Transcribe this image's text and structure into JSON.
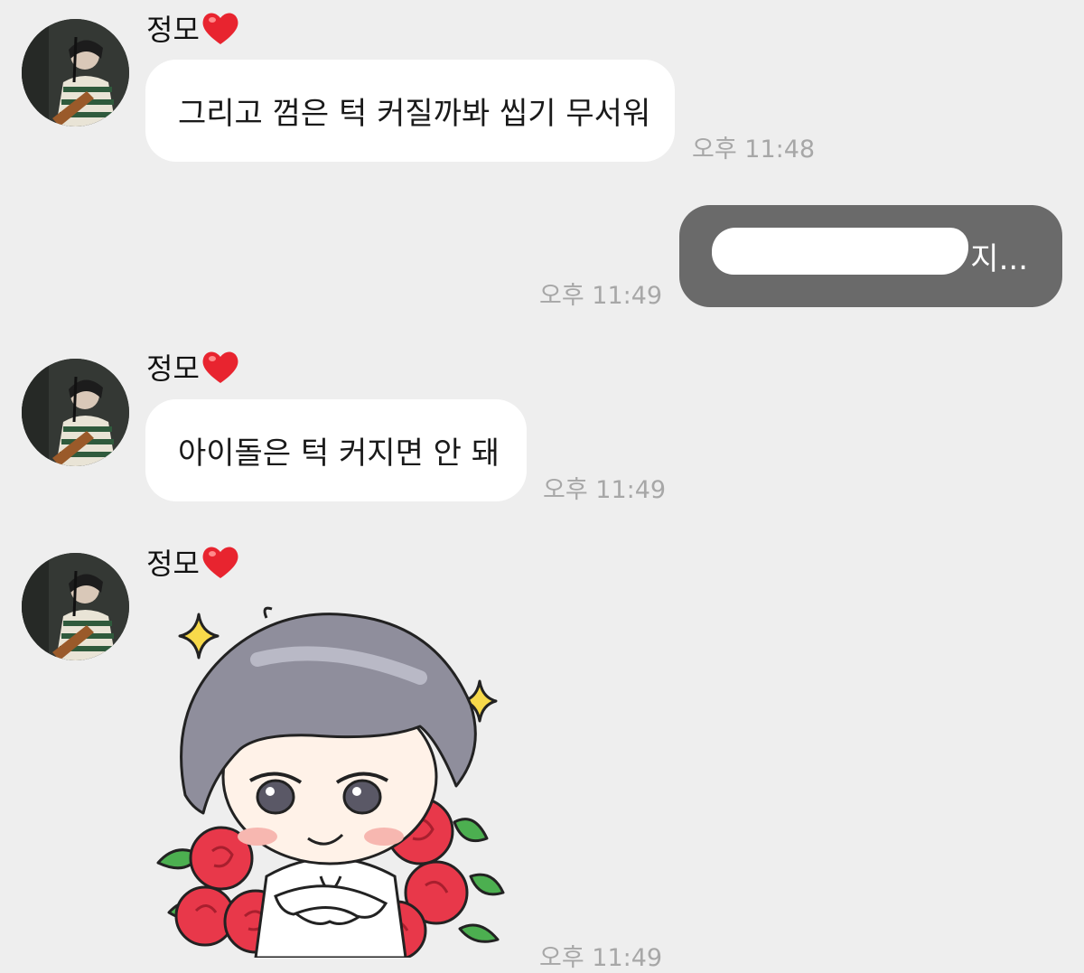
{
  "messages": [
    {
      "sender": "정모",
      "text": "그리고 껌은 턱 커질까봐 씹기 무서워",
      "time": "오후 11:48"
    },
    {
      "text": "지...",
      "time": "오후 11:49"
    },
    {
      "sender": "정모",
      "text": "아이돌은 턱 커지면 안 돼",
      "time": "오후 11:49"
    },
    {
      "sender": "정모",
      "sticker": "chibi-character-roses-sticker",
      "time": "오후 11:49"
    }
  ],
  "colors": {
    "background": "#eeeeee",
    "incoming_bubble": "#ffffff",
    "outgoing_bubble": "#6a6a6a",
    "timestamp": "#a7a7a7",
    "heart": "#e8242f"
  },
  "icons": {
    "sender_badge": "red-heart-icon",
    "avatar": "profile-photo"
  }
}
